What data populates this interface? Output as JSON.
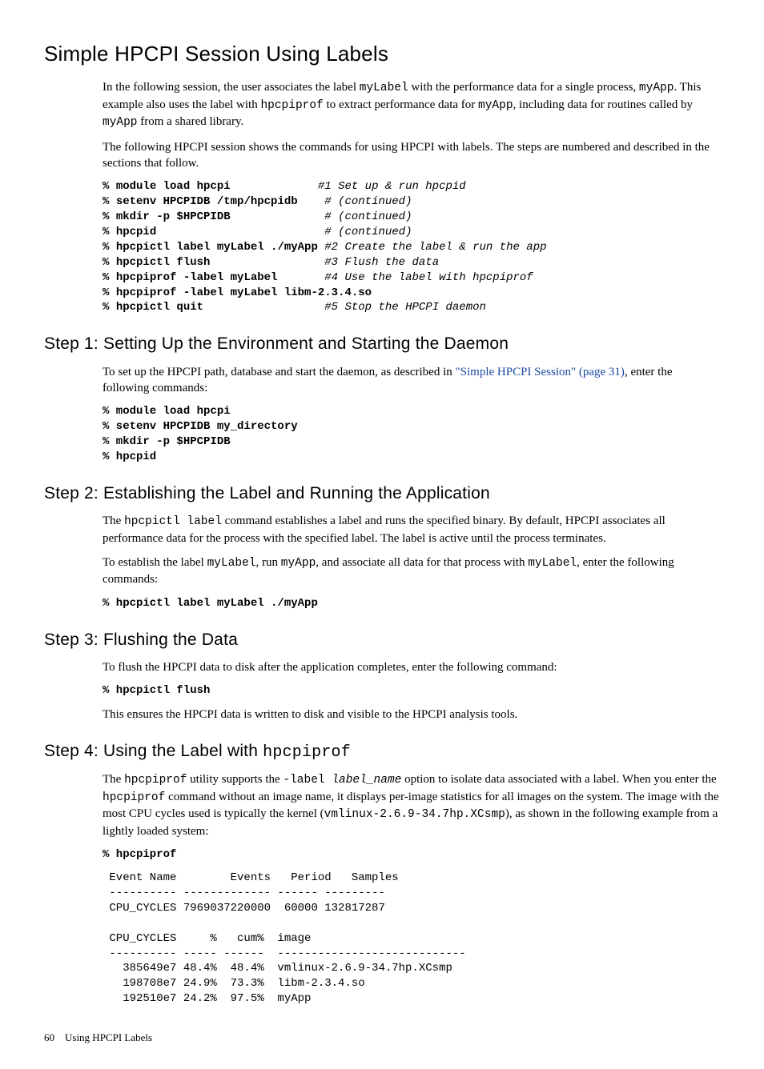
{
  "h1": "Simple HPCPI Session Using Labels",
  "intro": {
    "p1_a": "In the following session, the user associates the label ",
    "mylabel": "myLabel",
    "p1_b": " with the performance data for a single process, ",
    "myapp": "myApp",
    "p1_c": ". This example also uses the label with ",
    "hpcpiprof": "hpcpiprof",
    "p1_d": " to extract performance data for ",
    "p1_e": ", including data for routines called by ",
    "p1_f": " from a shared library.",
    "p2": "The following HPCPI session shows the commands for using HPCPI with labels. The steps are numbered and described in the sections that follow."
  },
  "code1": {
    "l1a": "% ",
    "l1b": "module load hpcpi",
    "l1c": "             ",
    "l1d": "#1 Set up & run hpcpid",
    "l2a": "% ",
    "l2b": "setenv HPCPIDB /tmp/hpcpidb",
    "l2c": "    ",
    "l2d": "# (continued)",
    "l3a": "% ",
    "l3b": "mkdir -p $HPCPIDB",
    "l3c": "              ",
    "l3d": "# (continued)",
    "l4a": "% ",
    "l4b": "hpcpid",
    "l4c": "                         ",
    "l4d": "# (continued)",
    "l5a": "% ",
    "l5b": "hpcpictl label myLabel ./myApp",
    "l5c": " ",
    "l5d": "#2 Create the label & run the app",
    "l6a": "% ",
    "l6b": "hpcpictl flush",
    "l6c": "                 ",
    "l6d": "#3 Flush the data",
    "l7a": "% ",
    "l7b": "hpcpiprof -label myLabel",
    "l7c": "       ",
    "l7d": "#4 Use the label with hpcpiprof",
    "l8a": "% ",
    "l8b": "hpcpiprof -label myLabel libm-2.3.4.so",
    "l9a": "% ",
    "l9b": "hpcpictl quit",
    "l9c": "                  ",
    "l9d": "#5 Stop the HPCPI daemon"
  },
  "step1": {
    "h": "Step 1: Setting Up the Environment and Starting the Daemon",
    "p_a": "To set up the HPCPI path, database and start the daemon, as described in ",
    "link": "\"Simple HPCPI Session\" (page 31)",
    "p_b": ", enter the following commands:",
    "code": "% module load hpcpi\n% setenv HPCPIDB my_directory\n% mkdir -p $HPCPIDB\n% hpcpid"
  },
  "step2": {
    "h": "Step 2: Establishing the Label and Running the Application",
    "p1_a": "The ",
    "cmd": "hpcpictl label",
    "p1_b": " command establishes a label and runs the specified binary. By default, HPCPI associates all performance data for the process with the specified label. The label is active until the process terminates.",
    "p2_a": "To establish the label ",
    "mylabel": "myLabel",
    "p2_b": ", run ",
    "myapp": "myApp",
    "p2_c": ", and associate all data for that process with ",
    "p2_d": ", enter the following commands:",
    "code": "% hpcpictl label myLabel ./myApp"
  },
  "step3": {
    "h": "Step 3: Flushing the Data",
    "p1": "To flush the HPCPI data to disk after the application completes, enter the following command:",
    "code": "% hpcpictl flush",
    "p2": "This ensures the HPCPI data is written to disk and visible to the HPCPI analysis tools."
  },
  "step4": {
    "h_a": "Step 4: Using the Label with ",
    "h_mono": "hpcpiprof",
    "p1_a": "The ",
    "hpcpiprof": "hpcpiprof",
    "p1_b": " utility supports the ",
    "opt": "-label ",
    "opt_ital": "label_name",
    "p1_c": " option to isolate data associated with a label. When you enter the ",
    "p1_d": " command without an image name, it displays per-image statistics for all images on the system. The image with the most CPU cycles used is typically the kernel (",
    "kernel": "vmlinux-2.6.9-34.7hp.XCsmp",
    "p1_e": "), as shown in the following example from a lightly loaded system:",
    "codecmd": "% hpcpiprof",
    "table": " Event Name        Events   Period   Samples\n ---------- ------------- ------ ---------\n CPU_CYCLES 7969037220000  60000 132817287\n\n CPU_CYCLES     %   cum%  image\n ---------- ----- ------  ----------------------------\n   385649e7 48.4%  48.4%  vmlinux-2.6.9-34.7hp.XCsmp\n   198708e7 24.9%  73.3%  libm-2.3.4.so\n   192510e7 24.2%  97.5%  myApp"
  },
  "footer": {
    "page": "60",
    "title": "Using HPCPI Labels"
  },
  "chart_data": {
    "type": "table",
    "title": "hpcpiprof output",
    "sections": [
      {
        "columns": [
          "Event Name",
          "Events",
          "Period",
          "Samples"
        ],
        "rows": [
          [
            "CPU_CYCLES",
            7969037220000,
            60000,
            132817287
          ]
        ]
      },
      {
        "columns": [
          "CPU_CYCLES",
          "%",
          "cum%",
          "image"
        ],
        "rows": [
          [
            "385649e7",
            48.4,
            48.4,
            "vmlinux-2.6.9-34.7hp.XCsmp"
          ],
          [
            "198708e7",
            24.9,
            73.3,
            "libm-2.3.4.so"
          ],
          [
            "192510e7",
            24.2,
            97.5,
            "myApp"
          ]
        ]
      }
    ]
  }
}
